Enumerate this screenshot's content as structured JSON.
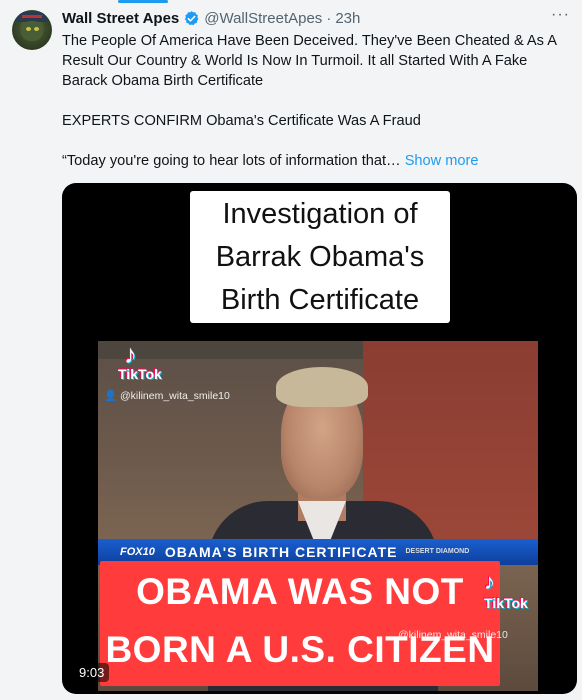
{
  "tweet": {
    "author_name": "Wall Street Apes",
    "handle": "@WallStreetApes",
    "separator": "·",
    "time": "23h",
    "more_label": "···",
    "text_para1": "The People Of America Have Been Deceived. They've Been Cheated & As A Result Our Country & World Is Now In Turmoil. It all Started With A Fake Barack Obama Birth Certificate",
    "text_para2": "EXPERTS CONFIRM Obama's Certificate Was A Fraud",
    "text_para3": "“Today you're going to hear lots of information that…",
    "show_more": "Show more"
  },
  "media": {
    "caption_line1": "Investigation of",
    "caption_line2": "Barrak Obama's",
    "caption_line3": "Birth Certificate",
    "tiktok_label": "TikTok",
    "tiktok_user": "@kilinem_wita_smile10",
    "news_logo": "FOX10",
    "news_headline": "OBAMA'S BIRTH CERTIFICATE",
    "news_sponsor": "DESERT DIAMOND",
    "banner_line1": "OBAMA WAS NOT",
    "banner_line2": "BORN A U.S. CITIZEN",
    "duration": "9:03"
  },
  "colors": {
    "accent": "#1d9bf0",
    "banner_red": "#ff3b3b",
    "news_blue": "#0d3f9b"
  },
  "icons": {
    "verified": "verified-badge-icon",
    "more": "more-options-icon"
  }
}
